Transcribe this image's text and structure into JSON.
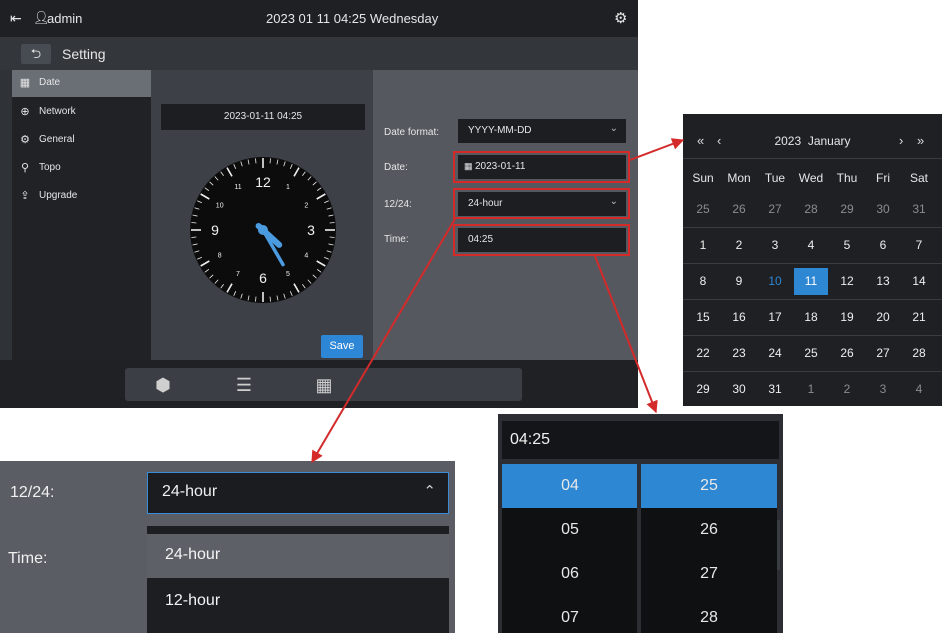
{
  "topbar": {
    "user": "admin",
    "datetime": "2023 01 11 04:25 Wednesday",
    "logout_icon": "logout-icon",
    "user_icon": "user-icon",
    "settings_icon": "gear-icon"
  },
  "subbar": {
    "back_icon": "back-arrow-icon",
    "title": "Setting"
  },
  "sidebar": {
    "items": [
      {
        "label": "Date",
        "icon": "calendar-icon"
      },
      {
        "label": "Network",
        "icon": "globe-icon"
      },
      {
        "label": "General",
        "icon": "gear-icon"
      },
      {
        "label": "Topo",
        "icon": "topology-icon"
      },
      {
        "label": "Upgrade",
        "icon": "upgrade-icon"
      }
    ],
    "active": "Date"
  },
  "clock": {
    "display": "2023-01-11 04:25",
    "numbers": [
      "12",
      "1",
      "2",
      "3",
      "4",
      "5",
      "6",
      "7",
      "8",
      "9",
      "10",
      "11"
    ],
    "hour": 4,
    "minute": 25
  },
  "save_label": "Save",
  "form": {
    "date_format_label": "Date format:",
    "date_format_value": "YYYY-MM-DD",
    "date_label": "Date:",
    "date_value": "2023-01-11",
    "hour_mode_label": "12/24:",
    "hour_mode_value": "24-hour",
    "time_label": "Time:",
    "time_value": "04:25"
  },
  "dock": {
    "icons": [
      "cube-icon",
      "server-icon",
      "calendar-icon"
    ]
  },
  "calendar": {
    "nav_prev_year": "«",
    "nav_prev_month": "‹",
    "nav_next_month": "›",
    "nav_next_year": "»",
    "year": "2023",
    "month": "January",
    "weekdays": [
      "Sun",
      "Mon",
      "Tue",
      "Wed",
      "Thu",
      "Fri",
      "Sat"
    ],
    "weeks": [
      [
        "25",
        "26",
        "27",
        "28",
        "29",
        "30",
        "31"
      ],
      [
        "1",
        "2",
        "3",
        "4",
        "5",
        "6",
        "7"
      ],
      [
        "8",
        "9",
        "10",
        "11",
        "12",
        "13",
        "14"
      ],
      [
        "15",
        "16",
        "17",
        "18",
        "19",
        "20",
        "21"
      ],
      [
        "22",
        "23",
        "24",
        "25",
        "26",
        "27",
        "28"
      ],
      [
        "29",
        "30",
        "31",
        "1",
        "2",
        "3",
        "4"
      ]
    ],
    "today": "10",
    "selected": "11",
    "accent": "#2d87d2"
  },
  "zoom_hour_mode": {
    "label": "12/24:",
    "time_label": "Time:",
    "value": "24-hour",
    "options": [
      "24-hour",
      "12-hour"
    ]
  },
  "zoom_time": {
    "header": "04:25",
    "hours": [
      "04",
      "05",
      "06",
      "07"
    ],
    "minutes": [
      "25",
      "26",
      "27",
      "28"
    ]
  },
  "colors": {
    "highlight_red": "#d42a2a",
    "accent_blue": "#2d87d2"
  }
}
